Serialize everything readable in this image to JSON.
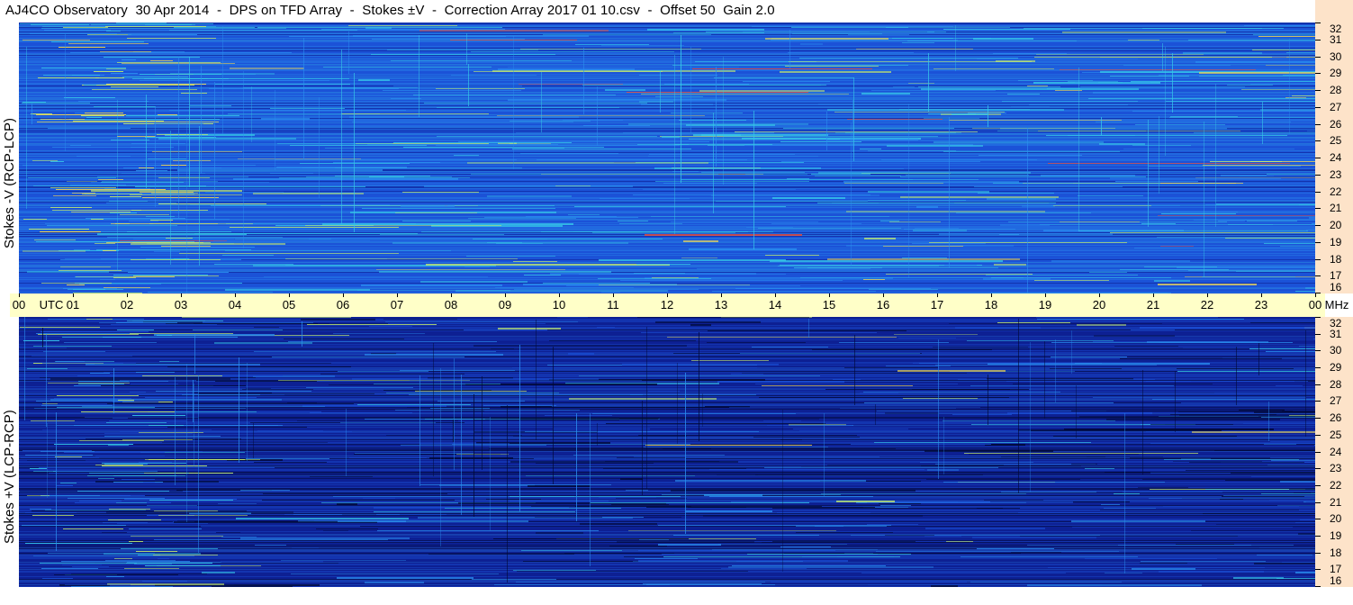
{
  "title": "AJ4CO Observatory  30 Apr 2014  -  DPS on TFD Array  -  Stokes ±V  -  Correction Array 2017 01 10.csv  -  Offset 50  Gain 2.0",
  "panels": {
    "top_label": "Stokes -V (RCP-LCP)",
    "bottom_label": "Stokes +V (LCP-RCP)"
  },
  "time_axis": {
    "labels": [
      "00",
      "01",
      "02",
      "03",
      "04",
      "05",
      "06",
      "07",
      "08",
      "09",
      "10",
      "11",
      "12",
      "13",
      "14",
      "15",
      "16",
      "17",
      "18",
      "19",
      "20",
      "21",
      "22",
      "23",
      "00"
    ],
    "unit_label": "UTC",
    "freq_unit": "MHz"
  },
  "chart_data": [
    {
      "type": "heatmap",
      "title": "Stokes -V (RCP-LCP)",
      "x_unit": "UTC",
      "x_ticks": [
        "00",
        "01",
        "02",
        "03",
        "04",
        "05",
        "06",
        "07",
        "08",
        "09",
        "10",
        "11",
        "12",
        "13",
        "14",
        "15",
        "16",
        "17",
        "18",
        "19",
        "20",
        "21",
        "22",
        "23",
        "00"
      ],
      "xlim": [
        0,
        24
      ],
      "y_unit": "MHz",
      "y_ticks": [
        32,
        31,
        30,
        29,
        28,
        27,
        26,
        25,
        24,
        23,
        22,
        21,
        20,
        19,
        18,
        17,
        16
      ],
      "ylim": [
        16,
        32
      ],
      "colormap": [
        "#0a1a8c",
        "#1a4fd6",
        "#2a8ff0",
        "#36c8e8",
        "#c9f06a",
        "#ffe14a",
        "#ff4a2a"
      ],
      "base_color": "#1d55d8"
    },
    {
      "type": "heatmap",
      "title": "Stokes +V (LCP-RCP)",
      "x_unit": "UTC",
      "x_ticks": [
        "00",
        "01",
        "02",
        "03",
        "04",
        "05",
        "06",
        "07",
        "08",
        "09",
        "10",
        "11",
        "12",
        "13",
        "14",
        "15",
        "16",
        "17",
        "18",
        "19",
        "20",
        "21",
        "22",
        "23",
        "00"
      ],
      "xlim": [
        0,
        24
      ],
      "y_unit": "MHz",
      "y_ticks": [
        32,
        31,
        30,
        29,
        28,
        27,
        26,
        25,
        24,
        23,
        22,
        21,
        20,
        19,
        18,
        17,
        16
      ],
      "ylim": [
        16,
        32
      ],
      "colormap": [
        "#000833",
        "#0a1a8c",
        "#1a4fd6",
        "#2a8ff0",
        "#36c8e8",
        "#c9f06a",
        "#ffe14a"
      ],
      "base_color": "#10259a"
    }
  ]
}
